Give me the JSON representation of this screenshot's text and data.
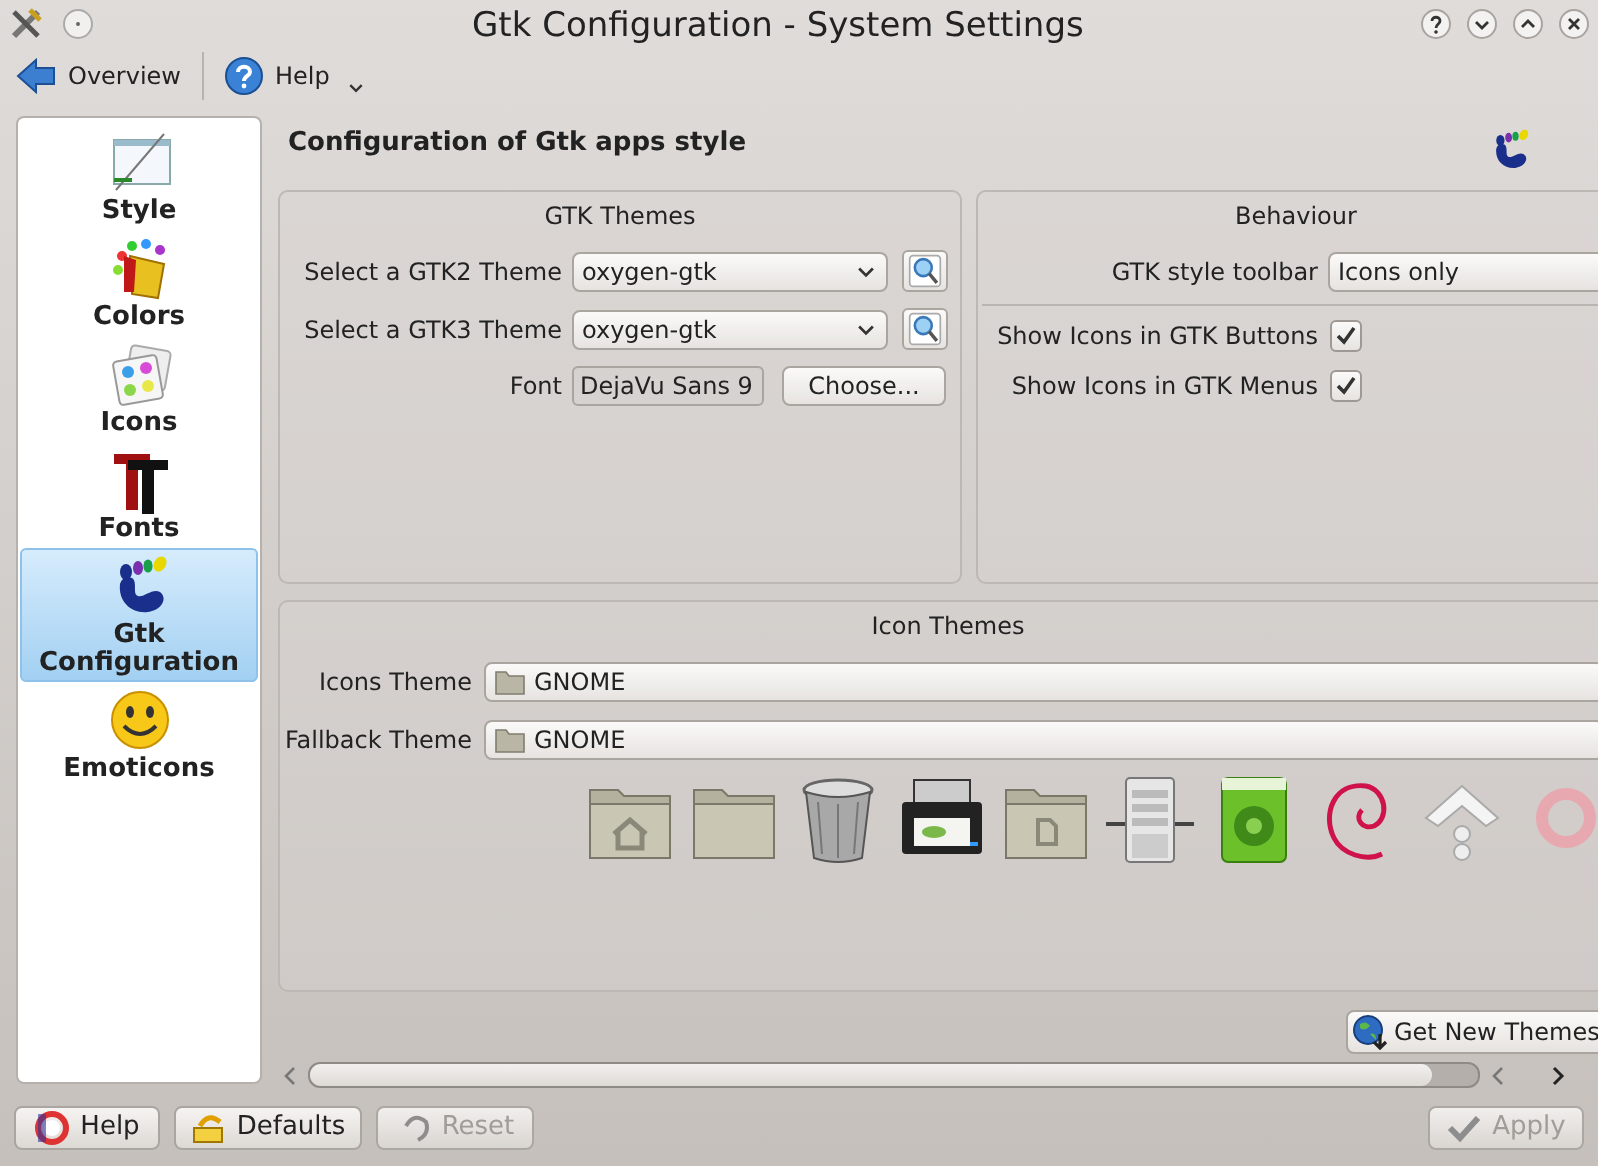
{
  "window": {
    "title": "Gtk Configuration - System Settings"
  },
  "toolbar": [
    {
      "label": "Overview",
      "kind": "back"
    },
    {
      "label": "Help",
      "kind": "help"
    }
  ],
  "sidebar": {
    "items": [
      {
        "label": "Style",
        "selected": false
      },
      {
        "label": "Colors",
        "selected": false
      },
      {
        "label": "Icons",
        "selected": false
      },
      {
        "label": "Fonts",
        "selected": false
      },
      {
        "label": "Gtk Configuration",
        "selected": true
      },
      {
        "label": "Emoticons",
        "selected": false
      }
    ]
  },
  "heading": "Configuration of Gtk apps style",
  "gtk_themes": {
    "title": "GTK Themes",
    "rows": [
      {
        "label": "Select a GTK2 Theme",
        "value": "oxygen-gtk"
      },
      {
        "label": "Select a GTK3 Theme",
        "value": "oxygen-gtk"
      }
    ],
    "font": {
      "label": "Font",
      "value": "DejaVu Sans 9",
      "button": "Choose..."
    }
  },
  "behaviour": {
    "title": "Behaviour",
    "toolbar_style": {
      "label": "GTK style toolbar",
      "value": "Icons only"
    },
    "checks": [
      {
        "label": "Show Icons in GTK Buttons",
        "checked": true
      },
      {
        "label": "Show Icons in GTK Menus",
        "checked": true
      }
    ]
  },
  "icon_themes": {
    "title": "Icon Themes",
    "rows": [
      {
        "label": "Icons Theme",
        "value": "GNOME"
      },
      {
        "label": "Fallback Theme",
        "value": "GNOME"
      }
    ]
  },
  "get_new_themes": "Get New Themes",
  "buttons": [
    {
      "label": "Help",
      "disabled": false,
      "kind": "help"
    },
    {
      "label": "Defaults",
      "disabled": false,
      "kind": "defaults"
    },
    {
      "label": "Reset",
      "disabled": true,
      "kind": "reset"
    },
    {
      "label": "Apply",
      "disabled": true,
      "kind": "apply"
    }
  ]
}
